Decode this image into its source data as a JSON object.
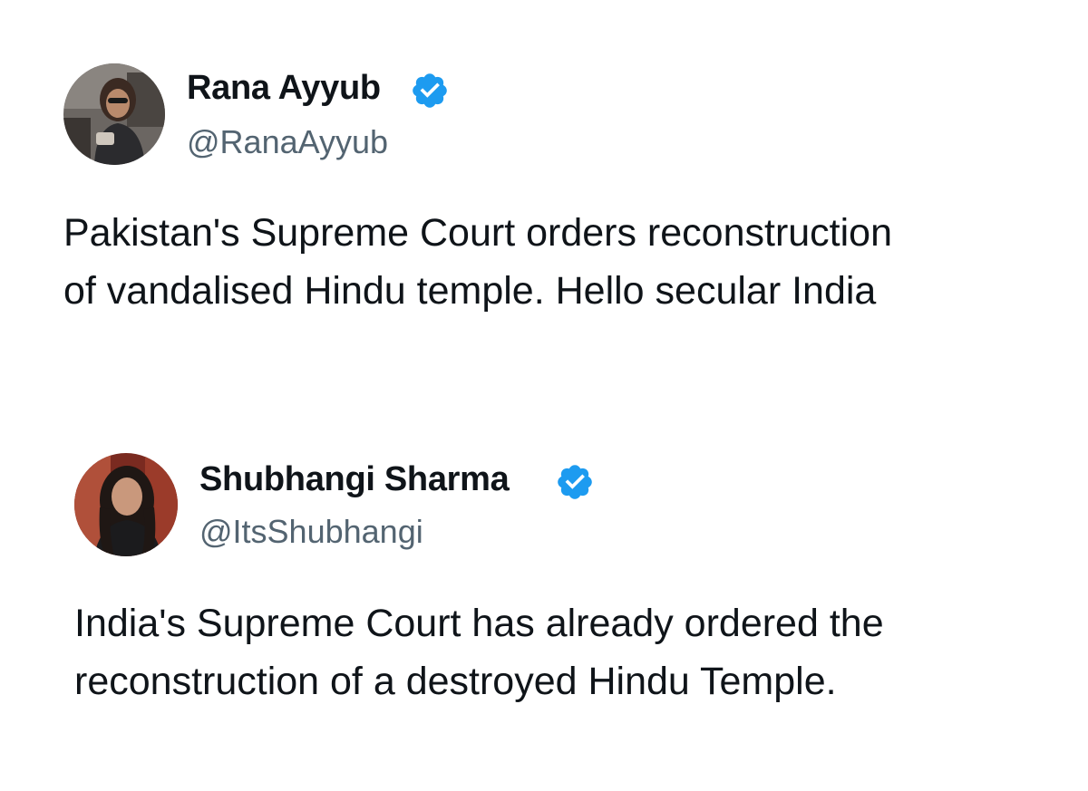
{
  "colors": {
    "text": "#0f1419",
    "handle": "#536471",
    "verified": "#1d9bf0",
    "background": "#ffffff"
  },
  "tweets": [
    {
      "author": {
        "display_name": "Rana Ayyub",
        "handle": "@RanaAyyub",
        "verified": true,
        "avatar_icon": "profile-photo"
      },
      "text_lines": [
        "Pakistan's Supreme Court orders reconstruction",
        "of vandalised Hindu temple. Hello secular India"
      ]
    },
    {
      "author": {
        "display_name": "Shubhangi Sharma",
        "handle": "@ItsShubhangi",
        "verified": true,
        "avatar_icon": "profile-photo"
      },
      "text_lines": [
        "India's Supreme Court has already ordered the",
        "reconstruction of a destroyed Hindu Temple."
      ]
    }
  ]
}
